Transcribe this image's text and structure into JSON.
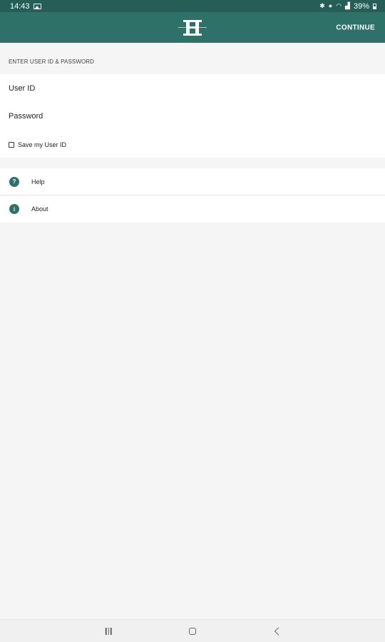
{
  "status_bar": {
    "time": "14:43",
    "battery": "39%",
    "icons": [
      "image-icon",
      "bluetooth-icon",
      "location-icon",
      "wifi-icon",
      "signal-icon",
      "battery-icon"
    ]
  },
  "app_bar": {
    "logo": "bank-logo-icon",
    "continue_label": "CONTINUE",
    "background": "#2e7168"
  },
  "login": {
    "section_label": "ENTER USER ID & PASSWORD",
    "user_id_placeholder": "User ID",
    "password_placeholder": "Password",
    "save_label": "Save my User ID",
    "save_checked": false
  },
  "menu": {
    "items": [
      {
        "label": "Help",
        "icon": "help-icon",
        "glyph": "?"
      },
      {
        "label": "About",
        "icon": "info-icon",
        "glyph": "i"
      }
    ]
  },
  "nav_bar": {
    "icons": [
      "recents-icon",
      "home-icon",
      "back-icon"
    ]
  }
}
